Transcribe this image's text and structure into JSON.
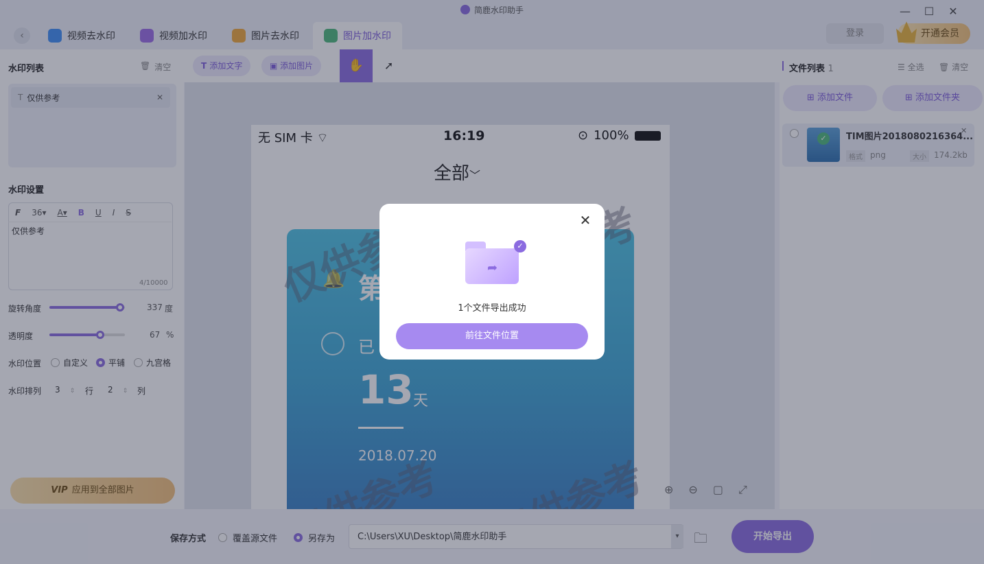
{
  "app": {
    "title": "简鹿水印助手"
  },
  "window": {
    "minimize": "—",
    "maximize": "☐",
    "close": "✕"
  },
  "tabs": [
    {
      "label": "视频去水印",
      "icon": "video-remove-icon",
      "color": "#3f8ef5"
    },
    {
      "label": "视频加水印",
      "icon": "video-add-icon",
      "color": "#9b6be6"
    },
    {
      "label": "图片去水印",
      "icon": "image-remove-icon",
      "color": "#f0a83a"
    },
    {
      "label": "图片加水印",
      "icon": "image-add-icon",
      "color": "#4cb87a",
      "active": true
    }
  ],
  "header": {
    "login": "登录",
    "vip": "开通会员",
    "vip_badge": "VIP"
  },
  "left": {
    "wm_list_title": "水印列表",
    "clear": "清空",
    "wm_item": "仅供参考",
    "settings_title": "水印设置",
    "font_size": "36",
    "text_content": "仅供参考",
    "char_count": "4/10000",
    "rotation_label": "旋转角度",
    "rotation_value": "337",
    "rotation_unit": "度",
    "rotation_fraction": 0.936,
    "opacity_label": "透明度",
    "opacity_value": "67",
    "opacity_unit": "%",
    "opacity_fraction": 0.67,
    "position_label": "水印位置",
    "pos_custom": "自定义",
    "pos_tile": "平铺",
    "pos_grid": "九宫格",
    "arrange_label": "水印排列",
    "rows": "3",
    "rows_unit": "行",
    "cols": "2",
    "cols_unit": "列",
    "apply_vip": "VIP",
    "apply_all": "应用到全部图片"
  },
  "center": {
    "add_text": "添加文字",
    "add_image": "添加图片",
    "phone": {
      "carrier": "无 SIM 卡",
      "time": "16:19",
      "battery": "100%",
      "header": "全部",
      "card_title_partial": "第",
      "card_sub_partial": "已",
      "days": "13",
      "days_unit": "天",
      "date": "2018.07.20"
    },
    "watermark": "仅供参考"
  },
  "right": {
    "title": "文件列表",
    "count": "1",
    "select_all": "全选",
    "clear": "清空",
    "add_file": "添加文件",
    "add_folder": "添加文件夹",
    "file": {
      "name": "TIM图片2018080216364...",
      "format_label": "格式",
      "format": "png",
      "size_label": "大小",
      "size": "174.2kb"
    }
  },
  "bottom": {
    "save_mode_label": "保存方式",
    "overwrite": "覆盖源文件",
    "save_as": "另存为",
    "path": "C:\\Users\\XU\\Desktop\\简鹿水印助手",
    "export": "开始导出"
  },
  "modal": {
    "message": "1个文件导出成功",
    "button": "前往文件位置"
  },
  "colors": {
    "accent": "#8b6be0",
    "accent_light": "#ede8fb",
    "vip_gold": "#f3c277"
  }
}
